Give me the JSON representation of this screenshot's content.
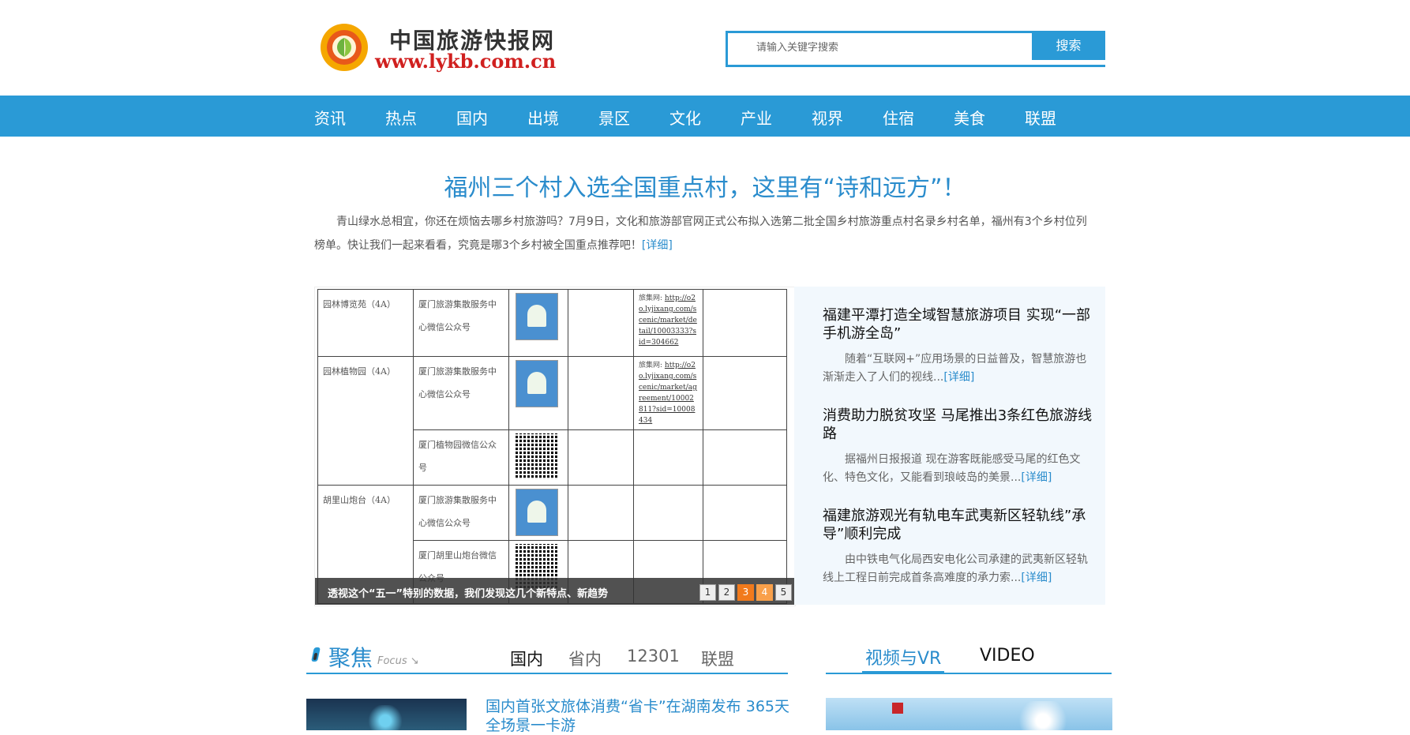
{
  "site": {
    "name_cn": "中国旅游快报网",
    "domain": "www.lykb.com.cn"
  },
  "search": {
    "placeholder": "请输入关键字搜索",
    "button": "搜索"
  },
  "nav": [
    "资讯",
    "热点",
    "国内",
    "出境",
    "景区",
    "文化",
    "产业",
    "视界",
    "住宿",
    "美食",
    "联盟"
  ],
  "headline": {
    "title": "福州三个村入选全国重点村，这里有“诗和远方”！",
    "summary": "青山绿水总相宜，你还在烦恼去哪乡村旅游吗？7月9日，文化和旅游部官网正式公布拟入选第二批全国乡村旅游重点村名录乡村名单，福州有3个乡村位列榜单。快让我们一起来看看，究竟是哪3个乡村被全国重点推荐吧！",
    "more": "[详细]"
  },
  "slider": {
    "caption": "透视这个“五一”特别的数据，我们发现这几个新特点、新趋势",
    "pages": [
      "1",
      "2",
      "3",
      "4",
      "5"
    ],
    "table": {
      "rows": [
        {
          "site": "园林博览苑（4A）",
          "account": "厦门旅游集散服务中心微信公众号",
          "url_prefix": "旅集网:",
          "url": "http://o2o.lyjixang.com/scenic/market/detail/10003333?sid=304662"
        },
        {
          "site": "园林植物园（4A）",
          "account": "厦门旅游集散服务中心微信公众号",
          "url_prefix": "旅集网:",
          "url": "http://o2o.lyjixang.com/scenic/market/agreement/10002811?sid=10008434"
        },
        {
          "account": "厦门植物园微信公众号"
        },
        {
          "site": "胡里山炮台（4A）",
          "account": "厦门旅游集散服务中心微信公众号"
        },
        {
          "account": "厦门胡里山炮台微信公众号"
        }
      ]
    }
  },
  "side_news": [
    {
      "title": "福建平潭打造全域智慧旅游项目 实现“一部手机游全岛”",
      "summary": "随着“互联网+”应用场景的日益普及，智慧旅游也渐渐走入了人们的视线...",
      "more": "[详细]"
    },
    {
      "title": "消费助力脱贫攻坚 马尾推出3条红色旅游线路",
      "summary": "据福州日报报道 现在游客既能感受马尾的红色文化、特色文化，又能看到琅岐岛的美景...",
      "more": "[详细]"
    },
    {
      "title": "福建旅游观光有轨电车武夷新区轻轨线”承导”顺利完成",
      "summary": "由中铁电气化局西安电化公司承建的武夷新区轻轨线上工程日前完成首条高难度的承力索...",
      "more": "[详细]"
    }
  ],
  "focus": {
    "title": "聚焦",
    "subtitle": "Focus ↘",
    "tabs": [
      "国内",
      "省内",
      "12301",
      "联盟"
    ],
    "news": "国内首张文旅体消费“省卡”在湖南发布 365天全场景一卡游"
  },
  "video": {
    "tabs": [
      "视频与VR",
      "VIDEO"
    ]
  },
  "colors": {
    "primary": "#2a9ad6",
    "link": "#2a8ccc",
    "logo_red": "#d0201f",
    "pager_active": "#f17a1c"
  }
}
